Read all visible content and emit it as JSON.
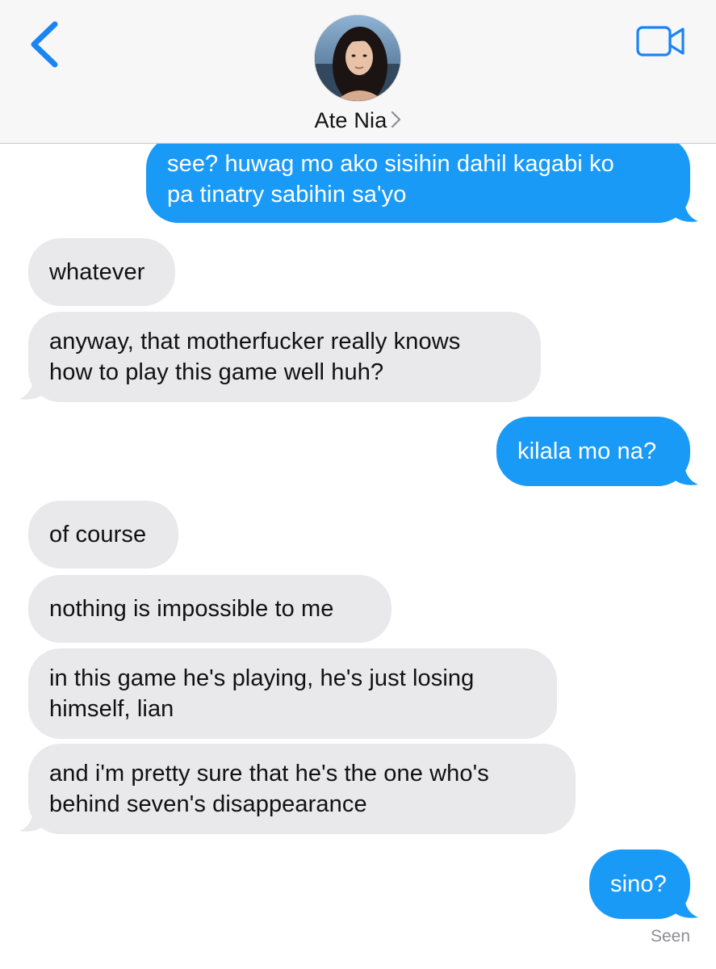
{
  "header": {
    "back_icon": "chevron-left-icon",
    "video_icon": "video-camera-icon",
    "contact_name": "Ate Nia",
    "contact_chevron": "chevron-right-icon"
  },
  "messages": [
    {
      "direction": "sent",
      "text": "see? huwag mo ako sisihin dahil kagabi ko\npa tinatry sabihin sa'yo"
    },
    {
      "direction": "received",
      "text": "whatever"
    },
    {
      "direction": "received",
      "text": "anyway, that motherfucker really knows\nhow to play this game well huh?"
    },
    {
      "direction": "sent",
      "text": "kilala mo na?"
    },
    {
      "direction": "received",
      "text": "of course"
    },
    {
      "direction": "received",
      "text": "nothing is impossible to me"
    },
    {
      "direction": "received",
      "text": "in this game he's playing, he's just losing\nhimself, lian"
    },
    {
      "direction": "received",
      "text": "and i'm pretty sure that he's the one who's\nbehind seven's disappearance"
    },
    {
      "direction": "sent",
      "text": "sino?"
    }
  ],
  "receipt": "Seen",
  "colors": {
    "sent_bubble": "#1a9af7",
    "received_bubble": "#e9e9eb",
    "accent": "#1a84f5"
  }
}
